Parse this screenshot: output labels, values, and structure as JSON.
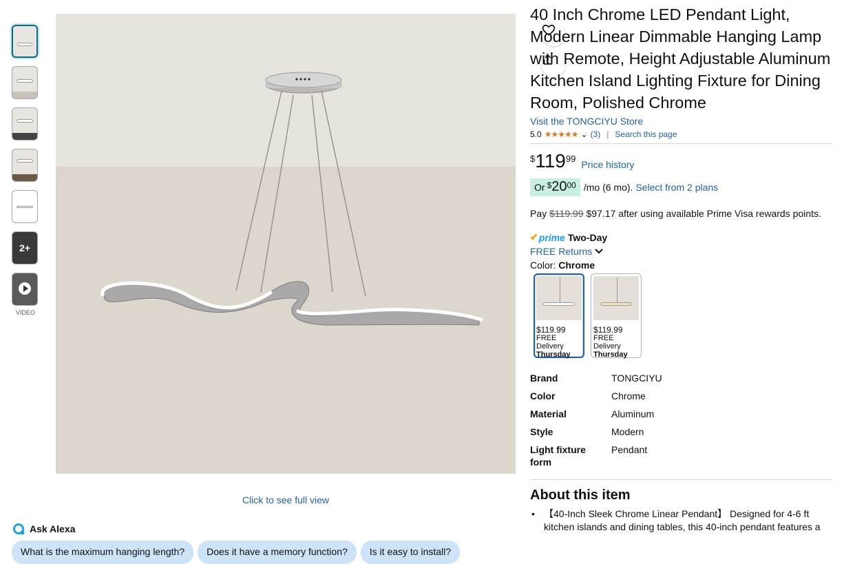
{
  "gallery": {
    "more_count": "2+",
    "video_label": "VIDEO",
    "full_view": "Click to see full view"
  },
  "alexa": {
    "label": "Ask Alexa",
    "questions": [
      "What is the maximum hanging length?",
      "Does it have a memory function?",
      "Is it easy to install?"
    ]
  },
  "product": {
    "title": "40 Inch Chrome LED Pendant Light, Modern Linear Dimmable Hanging Lamp with Remote, Height Adjustable Aluminum Kitchen Island Lighting Fixture for Dining Room, Polished Chrome",
    "store": "Visit the TONGCIYU Store",
    "rating": "5.0",
    "stars": "★★★★★",
    "review_count": "(3)",
    "search_page": "Search this page"
  },
  "price": {
    "symbol": "$",
    "whole": "119",
    "fraction": "99",
    "history": "Price history"
  },
  "plan": {
    "or": "Or",
    "symbol": "$",
    "whole": "20",
    "fraction": "00",
    "term": "/mo (6 mo).",
    "link": "Select from 2 plans"
  },
  "visa": {
    "pay": "Pay",
    "old_price": "$119.99",
    "new_text": "$97.17 after using available Prime Visa rewards points."
  },
  "delivery": {
    "check": "✔",
    "prime": "prime",
    "speed": "Two-Day",
    "returns": "FREE Returns"
  },
  "color": {
    "label": "Color:",
    "value": "Chrome",
    "options": [
      {
        "price": "$119.99",
        "delivery": "FREE Delivery",
        "day": "Thursday"
      },
      {
        "price": "$119.99",
        "delivery": "FREE Delivery",
        "day": "Thursday"
      }
    ]
  },
  "specs": [
    {
      "key": "Brand",
      "value": "TONGCIYU"
    },
    {
      "key": "Color",
      "value": "Chrome"
    },
    {
      "key": "Material",
      "value": "Aluminum"
    },
    {
      "key": "Style",
      "value": "Modern"
    },
    {
      "key": "Light fixture form",
      "value": "Pendant"
    }
  ],
  "about": {
    "title": "About this item",
    "bullets": [
      "【40-Inch Sleek Chrome Linear Pendant】 Designed for 4-6 ft kitchen islands and dining tables, this 40-inch pendant features a"
    ]
  },
  "colors": {
    "link": "#2162a1",
    "star": "#de7921",
    "prime_blue": "#1a98ff",
    "plan_badge": "#c7f0de",
    "chip": "#cce3f8"
  }
}
